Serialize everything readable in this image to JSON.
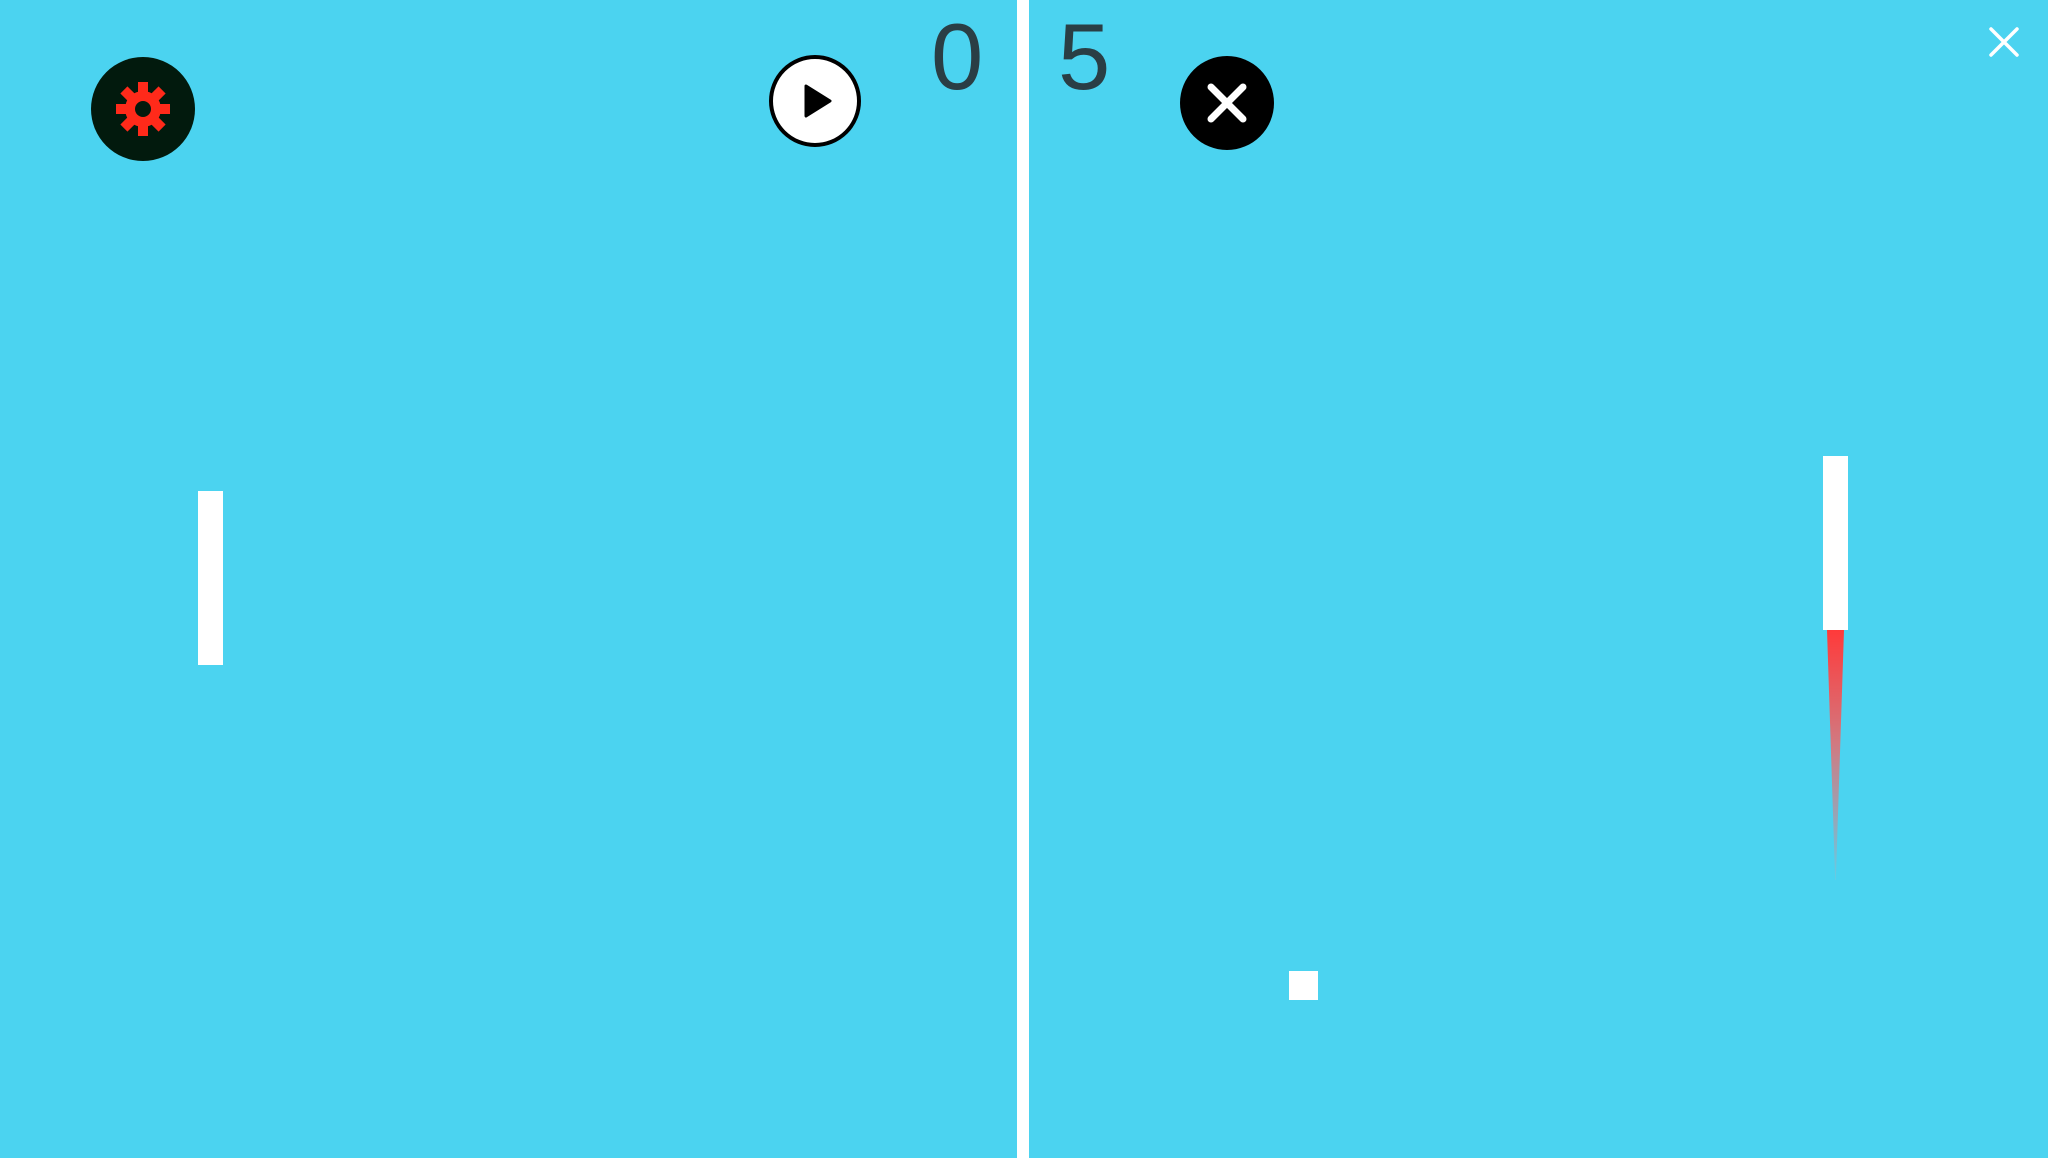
{
  "game": {
    "background_color": "#4bd3f0",
    "net_color": "#ffffff",
    "score": {
      "left": "0",
      "right": "5"
    }
  },
  "controls": {
    "settings": {
      "icon": "gear-icon",
      "icon_color": "#ff2a1a",
      "bg_color": "#021a0d"
    },
    "play": {
      "icon": "play-icon"
    },
    "exit": {
      "icon": "close-icon"
    },
    "window_close": {
      "icon": "close-icon"
    }
  },
  "entities": {
    "trail_color": "#ff3a3a"
  }
}
